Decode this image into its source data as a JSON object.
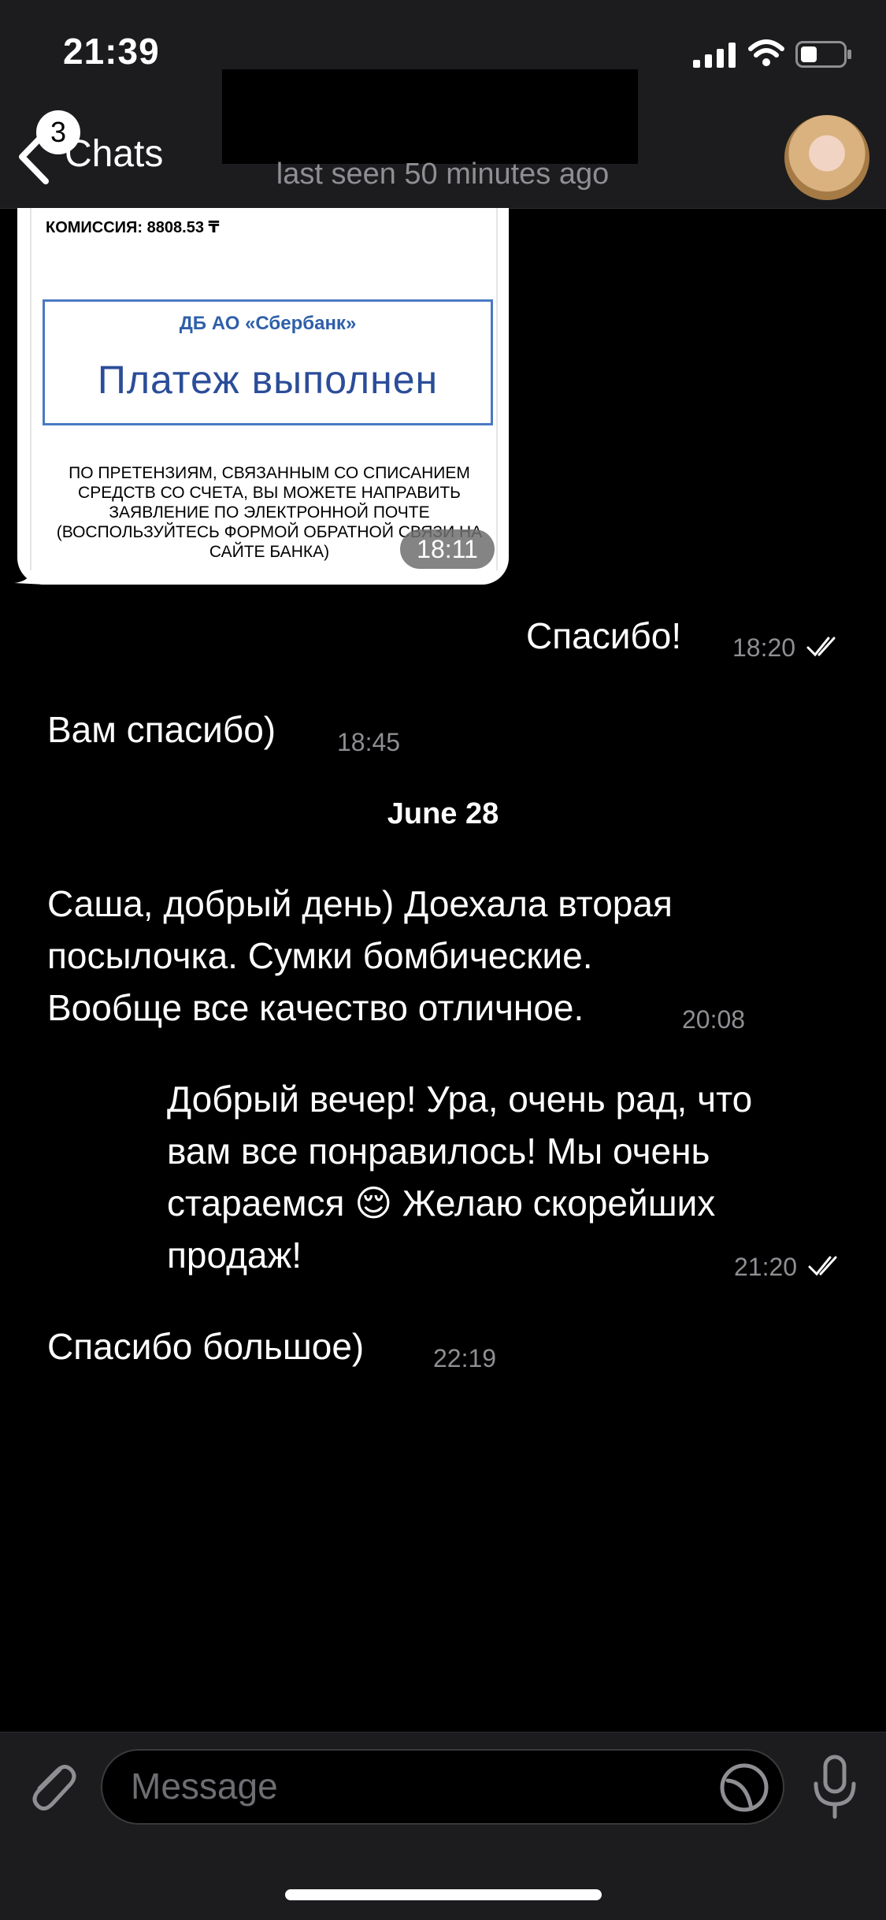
{
  "status_bar": {
    "time": "21:39"
  },
  "header": {
    "back_badge": "3",
    "back_label": "Chats",
    "status": "last seen 50 minutes ago"
  },
  "receipt": {
    "commission": "КОМИССИЯ: 8808.53 ₸",
    "bank": "ДБ АО «Сбербанк»",
    "status": "Платеж выполнен",
    "note": "ПО ПРЕТЕНЗИЯМ, СВЯЗАННЫМ СО СПИСАНИЕМ СРЕДСТВ СО СЧЕТА, ВЫ МОЖЕТЕ НАПРАВИТЬ ЗАЯВЛЕНИЕ ПО ЭЛЕКТРОННОЙ ПОЧТЕ (ВОСПОЛЬЗУЙТЕСЬ ФОРМОЙ ОБРАТНОЙ СВЯЗИ НА САЙТЕ БАНКА)",
    "time": "18:11"
  },
  "messages": [
    {
      "text": "Спасибо!",
      "time": "18:20",
      "outgoing": true
    },
    {
      "text": "Вам спасибо)",
      "time": "18:45",
      "outgoing": false
    },
    {
      "date": "June 28"
    },
    {
      "lines": [
        "Саша, добрый день) Доехала вторая",
        "посылочка. Сумки бомбические.",
        "Вообще все качество отличное."
      ],
      "time": "20:08",
      "outgoing": false
    },
    {
      "lines": [
        "Добрый вечер! Ура, очень рад, что",
        "вам все понравилось! Мы очень",
        "стараемся 😌 Желаю скорейших",
        "продаж!"
      ],
      "time": "21:20",
      "outgoing": true
    },
    {
      "text": "Спасибо большое)",
      "time": "22:19",
      "outgoing": false
    }
  ],
  "input": {
    "placeholder": "Message"
  }
}
